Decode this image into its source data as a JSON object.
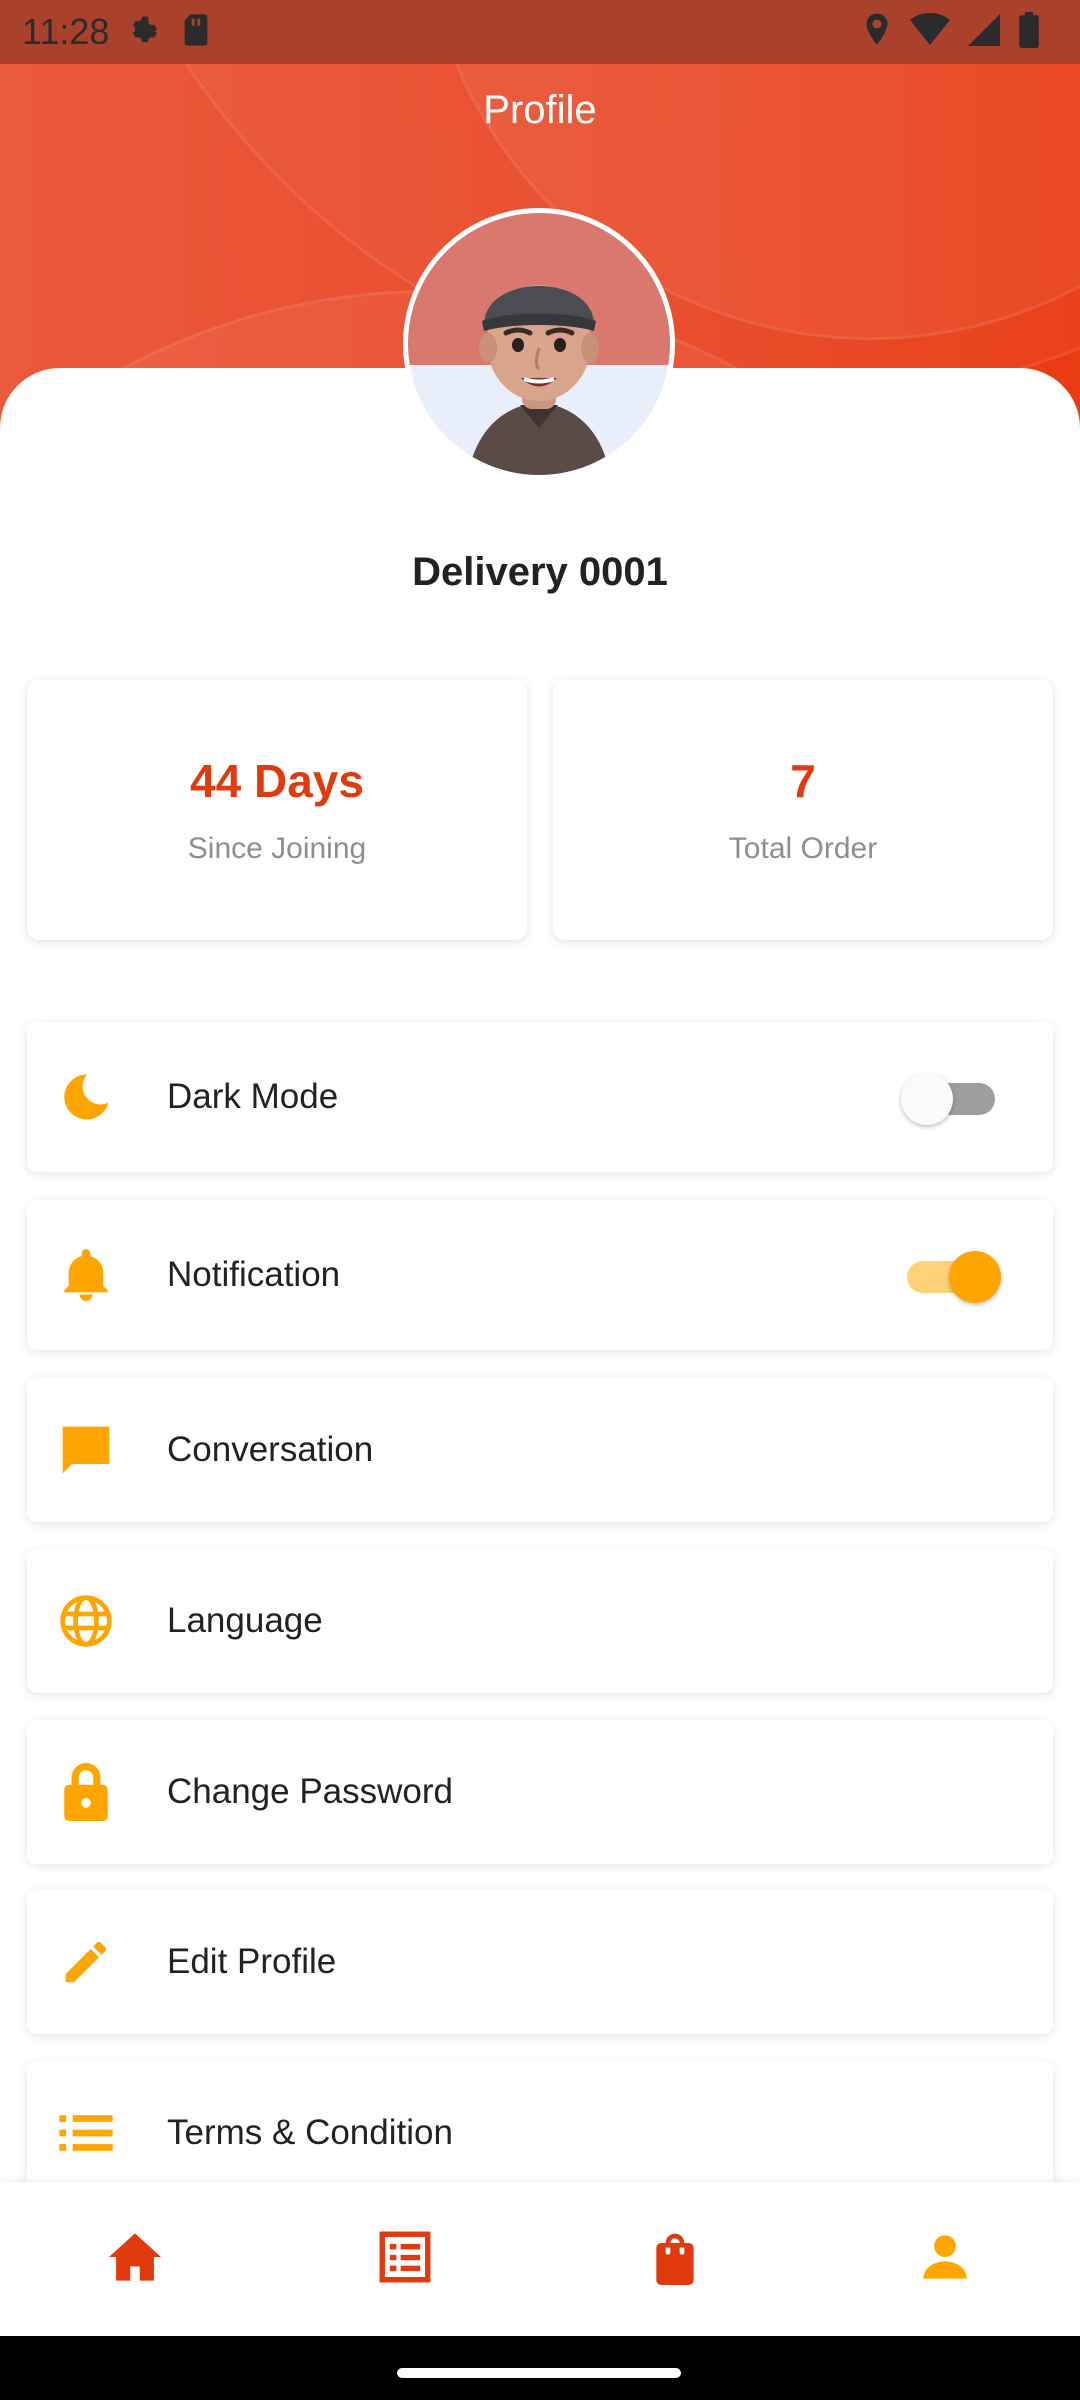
{
  "status_bar": {
    "time": "11:28",
    "icons": [
      "settings-icon",
      "sd-card-icon",
      "location-icon",
      "wifi-icon",
      "signal-icon",
      "battery-icon"
    ]
  },
  "header": {
    "title": "Profile"
  },
  "profile": {
    "name": "Delivery 0001"
  },
  "stats": [
    {
      "value": "44 Days",
      "label": "Since Joining"
    },
    {
      "value": "7",
      "label": "Total Order"
    }
  ],
  "menu": [
    {
      "label": "Dark Mode",
      "icon": "moon-icon",
      "toggle": "off"
    },
    {
      "label": "Notification",
      "icon": "bell-icon",
      "toggle": "on"
    },
    {
      "label": "Conversation",
      "icon": "chat-icon"
    },
    {
      "label": "Language",
      "icon": "globe-icon"
    },
    {
      "label": "Change Password",
      "icon": "lock-icon"
    },
    {
      "label": "Edit Profile",
      "icon": "pencil-icon"
    },
    {
      "label": "Terms & Condition",
      "icon": "list-icon"
    }
  ],
  "bottom_nav": {
    "items": [
      "home-icon",
      "orders-list-icon",
      "shopping-bag-icon",
      "profile-icon"
    ],
    "active": "profile-icon"
  },
  "colors": {
    "accent_red": "#E03A0F",
    "accent_orange": "#FFA500",
    "header_gradient_start": "#EA5A3C",
    "header_gradient_end": "#E93B14"
  }
}
